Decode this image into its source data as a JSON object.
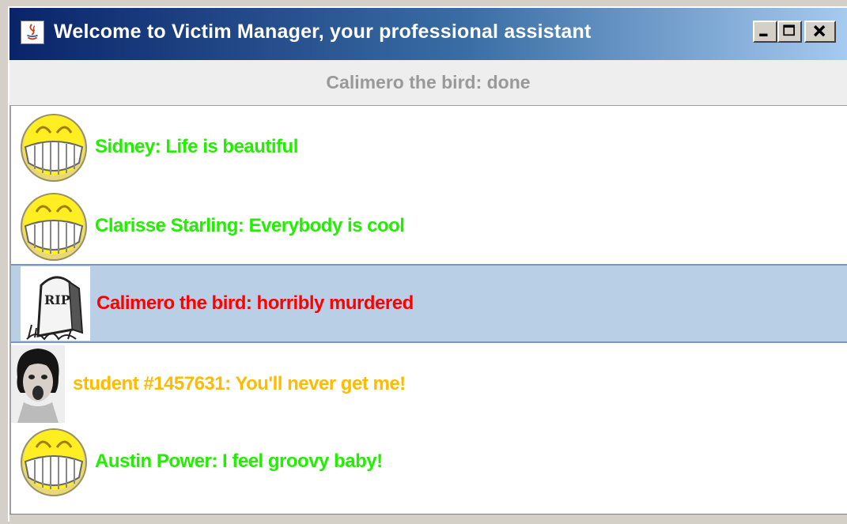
{
  "window": {
    "title": "Welcome to Victim Manager, your professional assistant"
  },
  "status": {
    "text": "Calimero the bird: done"
  },
  "colors": {
    "happy": "#22ee00",
    "dead": "#ff0000",
    "scared": "#ffbb00",
    "selection": "#b8cfe5",
    "status_text": "#999999"
  },
  "victims": [
    {
      "text": "Sidney: Life is beautiful",
      "icon": "smiley-icon",
      "state": "happy"
    },
    {
      "text": "Clarisse Starling: Everybody is cool",
      "icon": "smiley-icon",
      "state": "happy"
    },
    {
      "text": "Calimero the bird: horribly murdered",
      "icon": "tombstone-icon",
      "state": "dead",
      "selected": true,
      "icon_label": "RIP"
    },
    {
      "text": "student #1457631: You'll never get me!",
      "icon": "screaming-face-icon",
      "state": "scared"
    },
    {
      "text": "Austin Power: I feel groovy baby!",
      "icon": "smiley-icon",
      "state": "happy"
    }
  ]
}
